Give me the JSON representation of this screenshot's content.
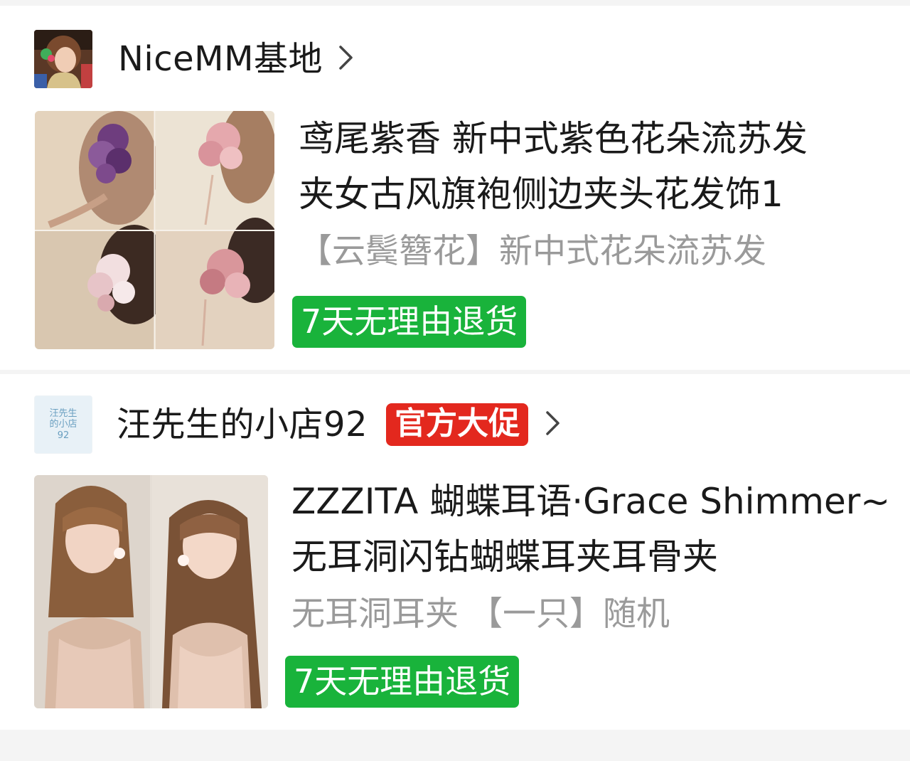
{
  "colors": {
    "badge_green": "#19b33b",
    "promo_red": "#e3281e",
    "spec_gray": "#9a9a9a",
    "divider": "#f4f4f4"
  },
  "shops": [
    {
      "name": "NiceMM基地",
      "has_promo": false,
      "avatar_icon": "portrait-avatar",
      "product": {
        "title_line1": "鸢尾紫香 新中式紫色花朵流苏发",
        "title_line2": "夹女古风旗袍侧边夹头花发饰1",
        "spec": "【云鬓簪花】新中式花朵流苏发",
        "badge": "7天无理由退货",
        "image_icon": "flower-hairpin-collage"
      }
    },
    {
      "name": "汪先生的小店92",
      "has_promo": true,
      "promo_tag": "官方大促",
      "avatar_text": [
        "汪先生",
        "的小店",
        "92"
      ],
      "product": {
        "title_line1": "ZZZITA 蝴蝶耳语·Grace Shimmer~",
        "title_line2": "无耳洞闪钻蝴蝶耳夹耳骨夹",
        "spec": "无耳洞耳夹 【一只】随机",
        "badge": "7天无理由退货",
        "image_icon": "model-photo-pair"
      }
    }
  ]
}
